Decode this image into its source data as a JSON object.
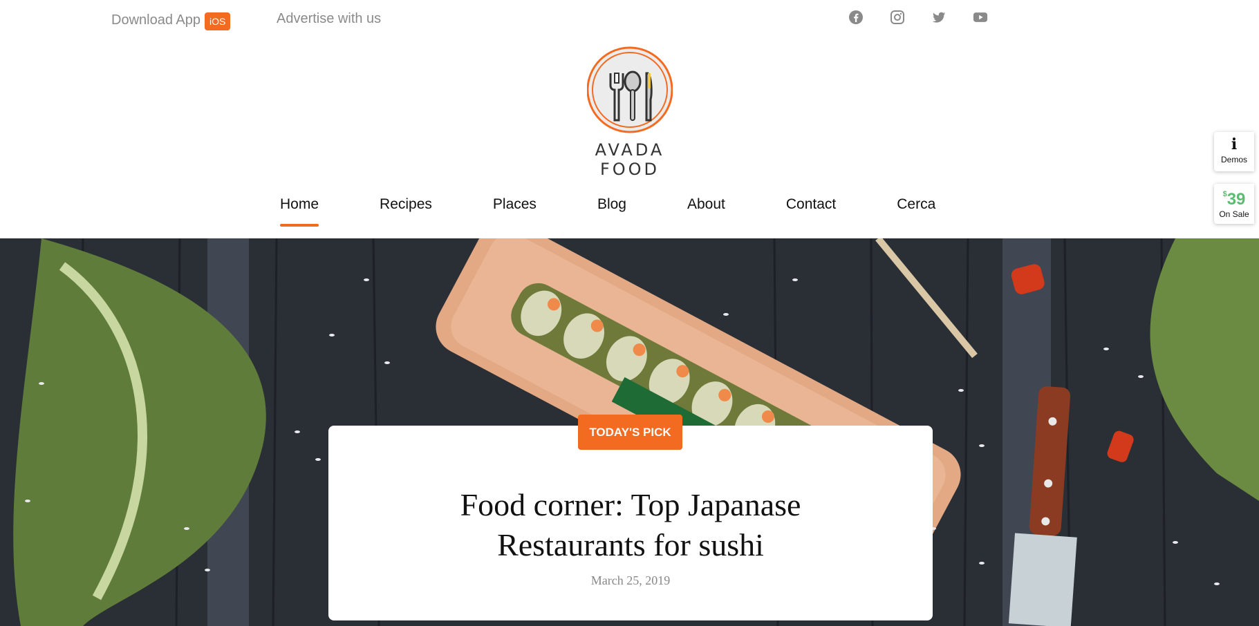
{
  "topbar": {
    "download_label": "Download App",
    "ios_badge": "iOS",
    "advertise_label": "Advertise with us",
    "social": [
      "facebook-icon",
      "instagram-icon",
      "twitter-icon",
      "youtube-icon"
    ]
  },
  "logo": {
    "brand": "AVADA FOOD"
  },
  "nav": {
    "items": [
      {
        "label": "Home",
        "active": true
      },
      {
        "label": "Recipes"
      },
      {
        "label": "Places"
      },
      {
        "label": "Blog"
      },
      {
        "label": "About"
      },
      {
        "label": "Contact"
      },
      {
        "label": "Cerca"
      }
    ]
  },
  "side": {
    "demos_icon": "i",
    "demos_label": "Demos",
    "price_currency": "$",
    "price": "39",
    "sale_label": "On Sale"
  },
  "hero": {
    "badge": "TODAY'S PICK",
    "title_line1": "Food corner: Top Japanase",
    "title_line2": "Restaurants for sushi",
    "date": "March 25, 2019"
  },
  "colors": {
    "accent": "#f26b21",
    "sale_green": "#5bbd71",
    "muted_text": "#8a8a8a"
  }
}
